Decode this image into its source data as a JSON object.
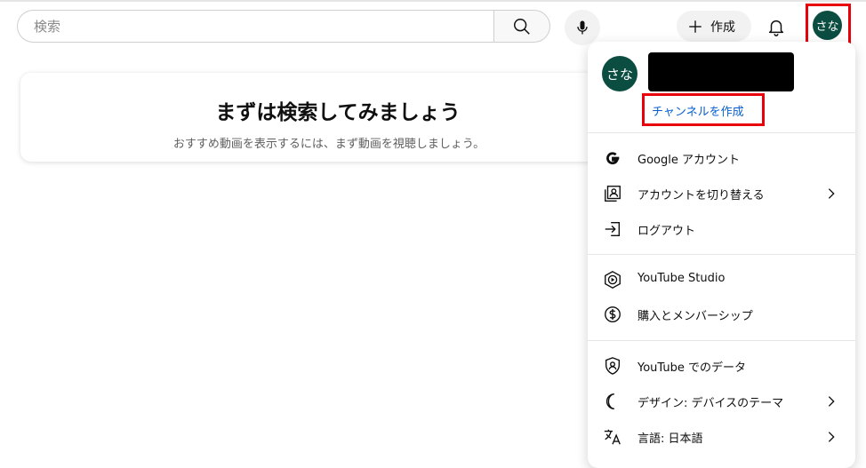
{
  "search": {
    "placeholder": "検索"
  },
  "header": {
    "create_label": "作成",
    "avatar_text": "さな"
  },
  "empty_state": {
    "title": "まずは検索してみましょう",
    "subtitle": "おすすめ動画を表示するには、まず動画を視聴しましょう。"
  },
  "account_menu": {
    "avatar_text": "さな",
    "create_channel_label": "チャンネルを作成",
    "items": [
      {
        "label": "Google アカウント",
        "icon": "google-icon",
        "has_submenu": false
      },
      {
        "label": "アカウントを切り替える",
        "icon": "switch-account-icon",
        "has_submenu": true
      },
      {
        "label": "ログアウト",
        "icon": "sign-out-icon",
        "has_submenu": false
      },
      {
        "label": "YouTube Studio",
        "icon": "youtube-studio-icon",
        "has_submenu": false
      },
      {
        "label": "購入とメンバーシップ",
        "icon": "dollar-icon",
        "has_submenu": false
      },
      {
        "label": "YouTube でのデータ",
        "icon": "shield-user-icon",
        "has_submenu": false
      },
      {
        "label": "デザイン: デバイスのテーマ",
        "icon": "moon-icon",
        "has_submenu": true
      },
      {
        "label": "言語: 日本語",
        "icon": "translate-icon",
        "has_submenu": true
      }
    ]
  },
  "colors": {
    "avatar_bg": "#0b4d41",
    "link": "#065fd4",
    "highlight": "#e8000b"
  }
}
